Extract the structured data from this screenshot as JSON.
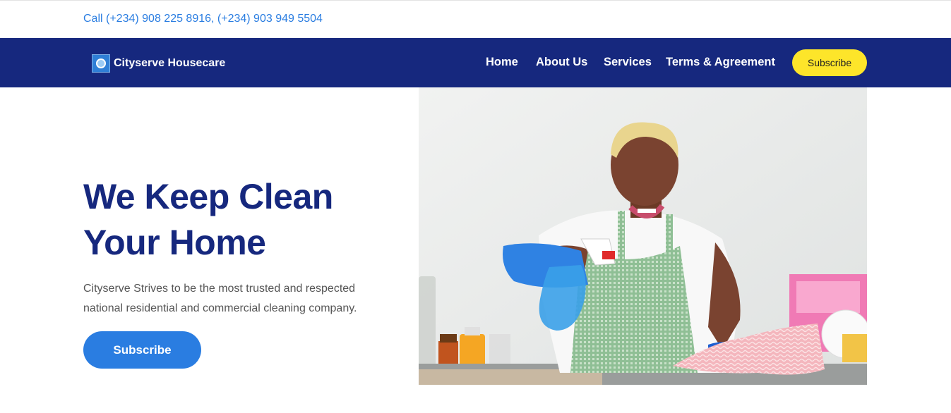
{
  "topbar": {
    "phone": "Call (+234) 908 225 8916, (+234) 903 949 5504"
  },
  "brand": {
    "name": "Cityserve Housecare",
    "icon": "company-logo-icon"
  },
  "nav": {
    "items": [
      "Home",
      "About Us",
      "Services",
      "Terms & Agreement"
    ],
    "subscribe_label": "Subscribe"
  },
  "hero": {
    "title": "We Keep Clean Your Home",
    "description": "Cityserve Strives to be the most trusted and respected national residential and commercial cleaning company.",
    "button_label": "Subscribe"
  },
  "colors": {
    "navbar": "#16287e",
    "accent_blue": "#2a7de1",
    "accent_yellow": "#fde52a",
    "title": "#16287e"
  }
}
